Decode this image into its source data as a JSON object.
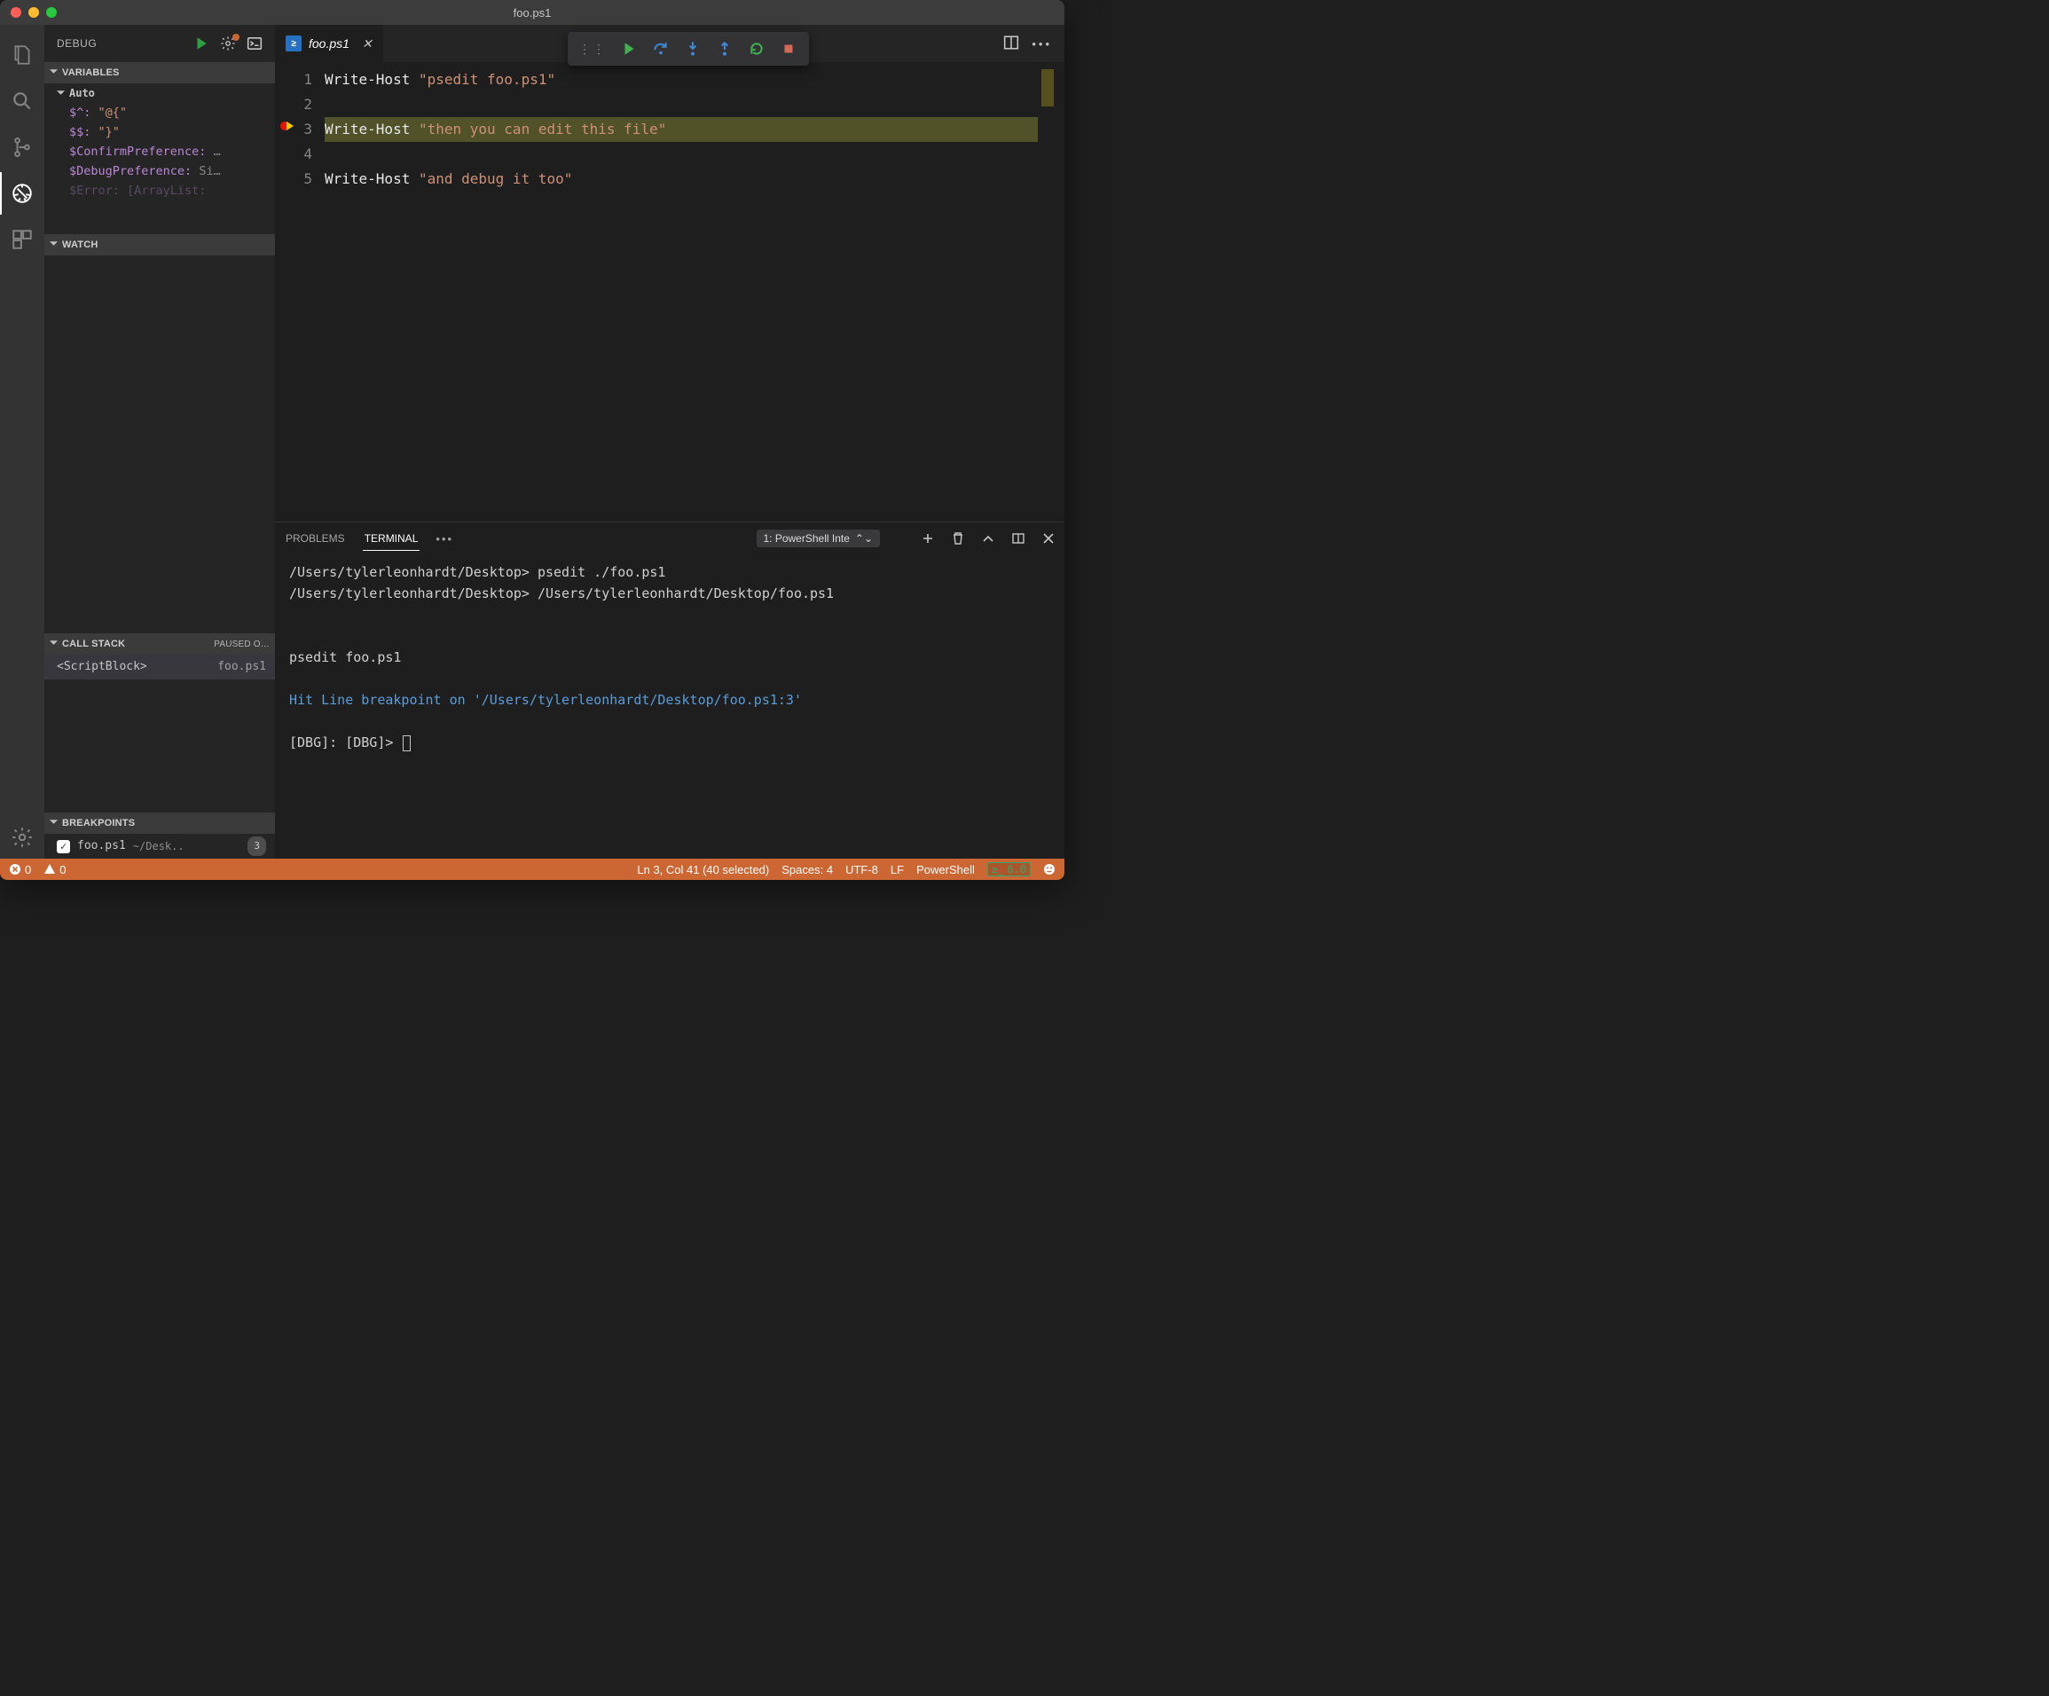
{
  "window_title": "foo.ps1",
  "sidebar": {
    "title": "DEBUG",
    "variables": {
      "header": "VARIABLES",
      "group": "Auto",
      "rows": [
        {
          "name": "$^:",
          "value": "\"@{\""
        },
        {
          "name": "$$:",
          "value": "\"}\""
        },
        {
          "name": "$ConfirmPreference:",
          "value": "…"
        },
        {
          "name": "$DebugPreference:",
          "value": "Si…"
        }
      ],
      "cutoff": "$Error: [ArrayList:"
    },
    "watch": {
      "header": "WATCH"
    },
    "callstack": {
      "header": "CALL STACK",
      "extra": "PAUSED O…",
      "frame_left": "<ScriptBlock>",
      "frame_right": "foo.ps1"
    },
    "breakpoints": {
      "header": "BREAKPOINTS",
      "row": {
        "file": "foo.ps1",
        "path": "~/Desk..",
        "line": "3"
      }
    }
  },
  "tab": {
    "label": "foo.ps1"
  },
  "code": {
    "lines": [
      "1",
      "2",
      "3",
      "4",
      "5"
    ],
    "l1_cmd": "Write-Host ",
    "l1_str": "\"psedit foo.ps1\"",
    "l3_cmd": "Write-Host ",
    "l3_str": "\"then you can edit this file\"",
    "l5_cmd": "Write-Host ",
    "l5_str": "\"and debug it too\""
  },
  "panel": {
    "problems": "PROBLEMS",
    "terminal": "TERMINAL",
    "dropdown": "1: PowerShell Inte",
    "term": {
      "l1": "/Users/tylerleonhardt/Desktop> psedit ./foo.ps1",
      "l2": "/Users/tylerleonhardt/Desktop> /Users/tylerleonhardt/Desktop/foo.ps1",
      "l3": "psedit foo.ps1",
      "hit1": "Hit Line breakpoint on '/Users/tylerleonhardt/Desktop/foo.ps1:3'",
      "prompt": "[DBG]:  [DBG]> "
    }
  },
  "status": {
    "errors": "0",
    "warnings": "0",
    "pos": "Ln 3, Col 41 (40 selected)",
    "spaces": "Spaces: 4",
    "enc": "UTF-8",
    "eol": "LF",
    "lang": "PowerShell",
    "ps": "6.0"
  }
}
